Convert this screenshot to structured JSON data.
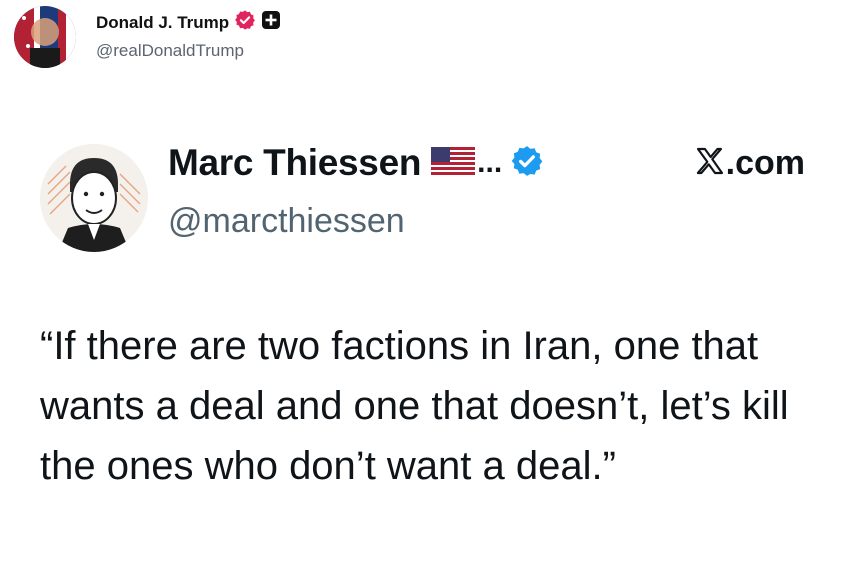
{
  "post": {
    "author_name": "Donald J. Trump",
    "author_handle": "@realDonaldTrump"
  },
  "quoted": {
    "author_name": "Marc Thiessen",
    "ellipsis": "...",
    "author_handle": "@marcthiessen",
    "site_label": ".com",
    "body": "“If there are two factions in Iran, one that wants a deal and one that doesn’t, let’s kill the ones who don’t want a deal.”"
  },
  "icons": [
    "avatar-portrait",
    "verified-badge-icon",
    "plus-badge-icon",
    "us-flag-icon",
    "x-logo-icon"
  ],
  "colors": {
    "verified_pink": "#e0245e",
    "verified_blue": "#1d9bf0",
    "text": "#0f1419",
    "muted": "#536471"
  }
}
